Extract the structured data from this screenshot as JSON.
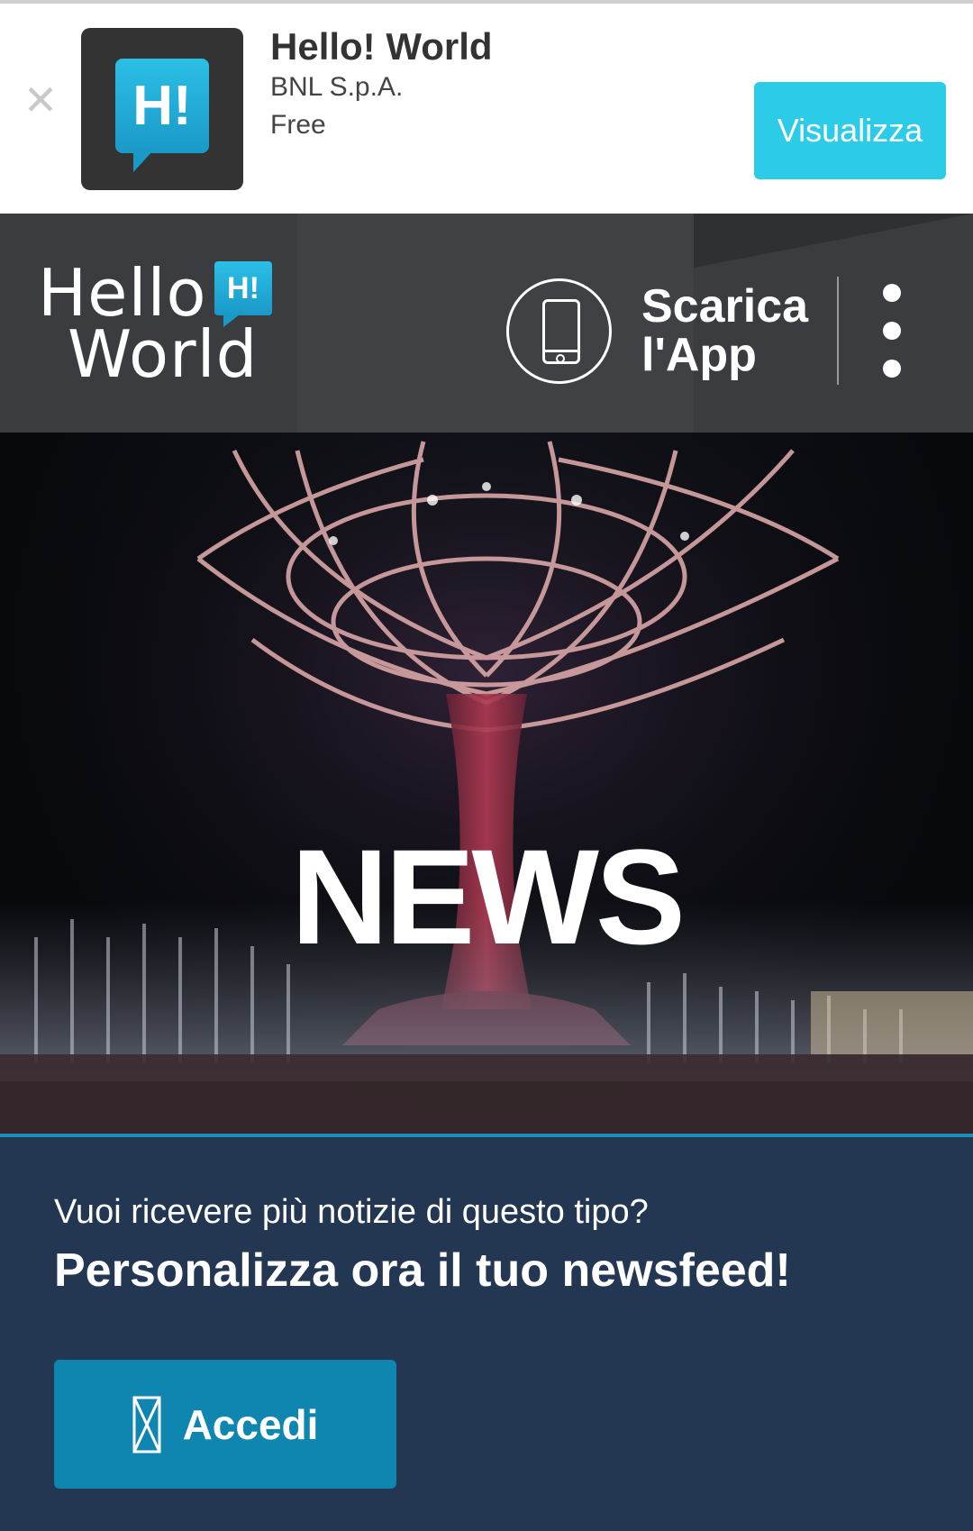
{
  "app_banner": {
    "close_symbol": "✕",
    "icon_text": "H!",
    "title": "Hello! World",
    "publisher": "BNL S.p.A.",
    "price": "Free",
    "view_button_label": "Visualizza",
    "accent_color": "#2ccbe8"
  },
  "header": {
    "logo": {
      "line1": "Hello",
      "line2": "World",
      "badge": "H!"
    },
    "download_app_label_line1": "Scarica",
    "download_app_label_line2": "l'App",
    "download_icon": "smartphone-icon",
    "menu_icon": "kebab-menu-icon"
  },
  "hero": {
    "title": "NEWS",
    "image": "illuminated-tree-structure-with-fountains"
  },
  "personalize": {
    "question": "Vuoi ricevere più notizie di questo tipo?",
    "headline": "Personalizza ora il tuo newsfeed!",
    "login_label": "Accedi",
    "login_icon": "login-icon",
    "background_color": "#233752",
    "button_color": "#0f86b0"
  }
}
